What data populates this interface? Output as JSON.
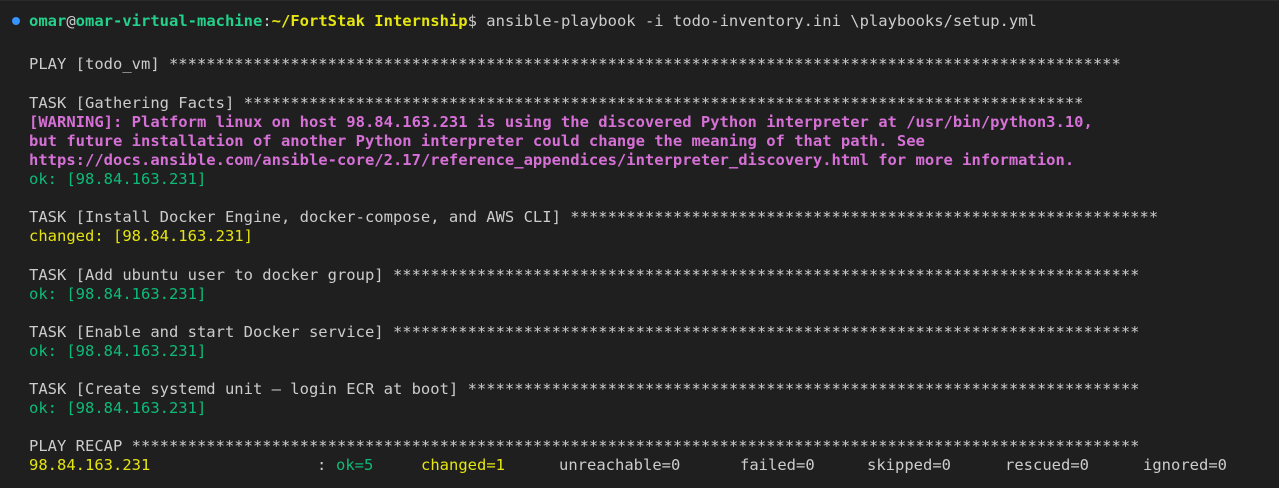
{
  "theme": {
    "background": "#1f1f1f",
    "foreground": "#cccccc",
    "ok_color": "#0dbc79",
    "changed_color": "#e5e510",
    "warning_color": "#d670d6",
    "prompt_user_color": "#23d18b",
    "prompt_path_color": "#e5e510",
    "status_dot_color": "#3794ff",
    "status_dot_icon": "circle-icon"
  },
  "prompt": {
    "user": "omar",
    "at": "@",
    "host": "omar-virtual-machine",
    "colon": ":",
    "path": "~/FortStak Internship",
    "dollar": "$",
    "command": " ansible-playbook -i todo-inventory.ini \\playbooks/setup.yml"
  },
  "output": {
    "play_header": "PLAY [todo_vm] ******************************************************************************************************",
    "tasks": [
      {
        "header": "TASK [Gathering Facts] ******************************************************************************************",
        "warning_lines": [
          "[WARNING]: Platform linux on host 98.84.163.231 is using the discovered Python interpreter at /usr/bin/python3.10,",
          "but future installation of another Python interpreter could change the meaning of that path. See",
          "https://docs.ansible.com/ansible-core/2.17/reference_appendices/interpreter_discovery.html for more information."
        ],
        "result": "ok: [98.84.163.231]"
      },
      {
        "header": "TASK [Install Docker Engine, docker-compose, and AWS CLI] ***************************************************************",
        "result": "changed: [98.84.163.231]"
      },
      {
        "header": "TASK [Add ubuntu user to docker group] ********************************************************************************",
        "result": "ok: [98.84.163.231]"
      },
      {
        "header": "TASK [Enable and start Docker service] ********************************************************************************",
        "result": "ok: [98.84.163.231]"
      },
      {
        "header": "TASK [Create systemd unit — login ECR at boot] ************************************************************************",
        "result": "ok: [98.84.163.231]"
      }
    ],
    "recap_header": "PLAY RECAP ************************************************************************************************************",
    "recap": {
      "host": "98.84.163.231",
      "sep": ": ",
      "ok": "ok=5",
      "changed": "changed=1",
      "unreachable": "unreachable=0",
      "failed": "failed=0",
      "skipped": "skipped=0",
      "rescued": "rescued=0",
      "ignored": "ignored=0"
    }
  }
}
